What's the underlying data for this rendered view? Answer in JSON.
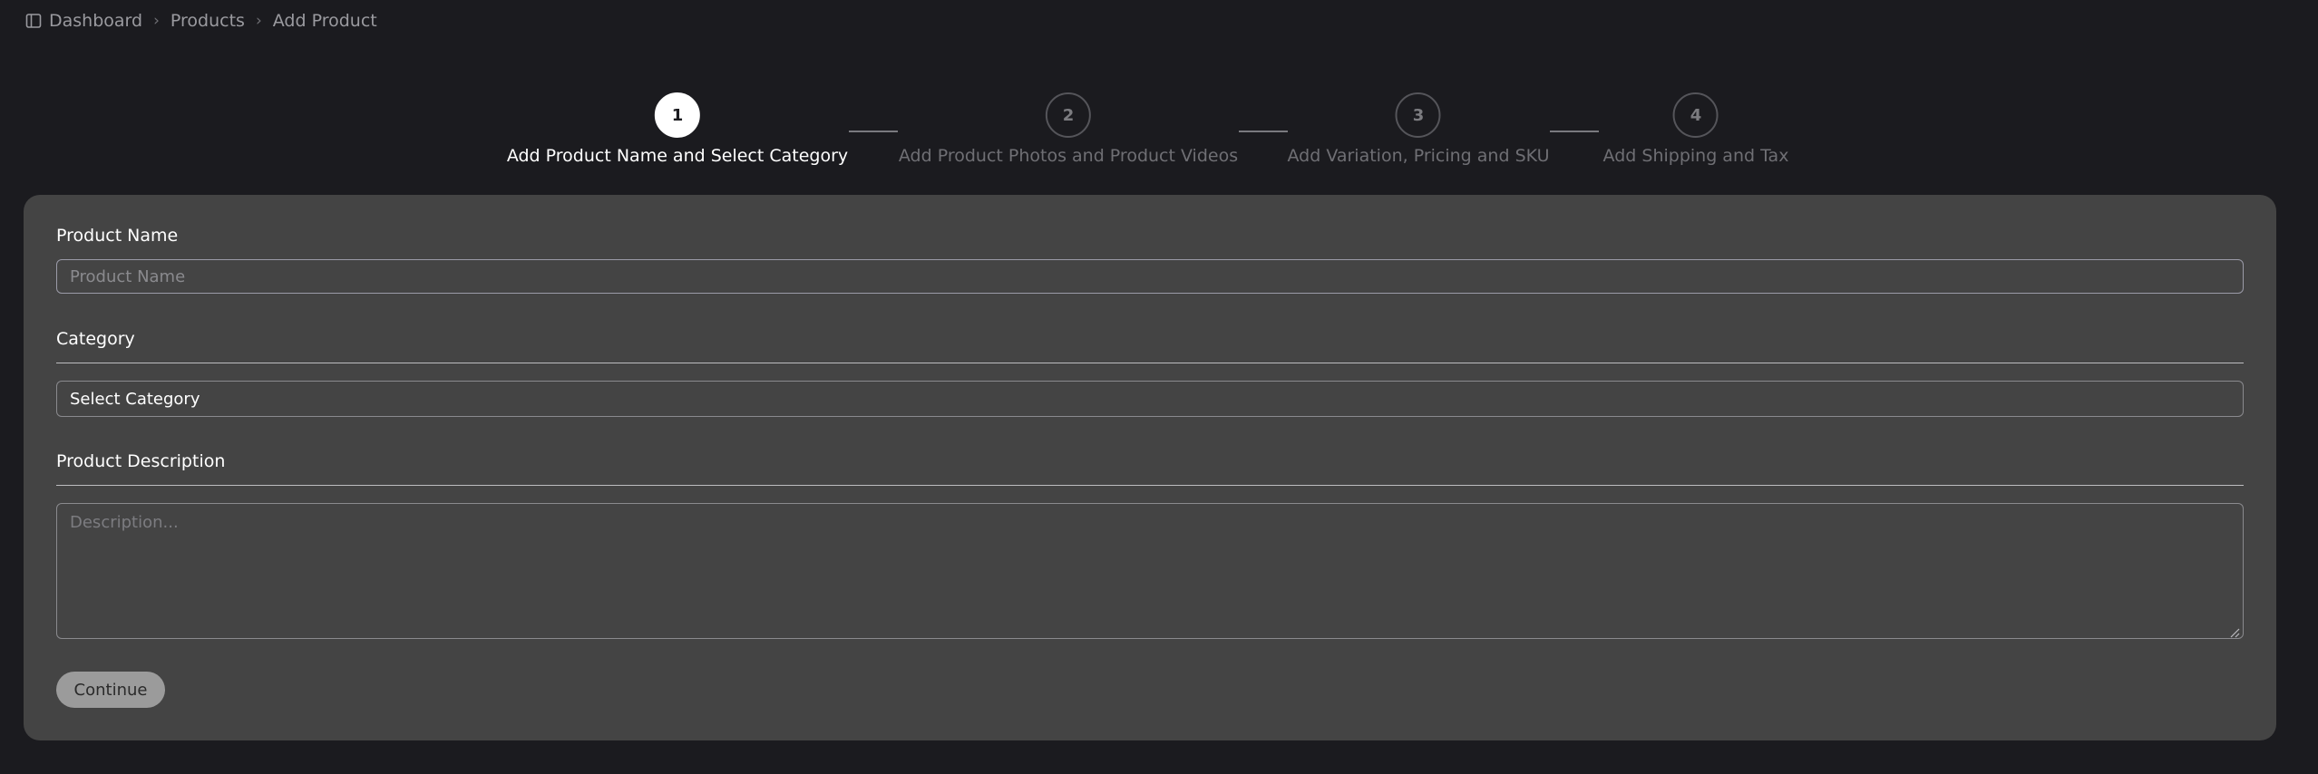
{
  "breadcrumb": {
    "icon": "sidebar-panel-icon",
    "items": [
      "Dashboard",
      "Products",
      "Add Product"
    ]
  },
  "stepper": {
    "steps": [
      {
        "number": "1",
        "label": "Add Product Name and Select Category",
        "active": true
      },
      {
        "number": "2",
        "label": "Add Product Photos and Product Videos",
        "active": false
      },
      {
        "number": "3",
        "label": "Add Variation, Pricing and SKU",
        "active": false
      },
      {
        "number": "4",
        "label": "Add Shipping and Tax",
        "active": false
      }
    ]
  },
  "form": {
    "product_name": {
      "label": "Product Name",
      "value": "",
      "placeholder": "Product Name"
    },
    "category": {
      "label": "Category",
      "selected": "Select Category"
    },
    "description": {
      "label": "Product Description",
      "value": "",
      "placeholder": "Description..."
    },
    "continue_label": "Continue"
  },
  "colors": {
    "background": "#1b1b1f",
    "panel": "#444444",
    "active_step": "#ffffff",
    "inactive_step": "#6f6f74",
    "button": "#9b9b9b"
  }
}
